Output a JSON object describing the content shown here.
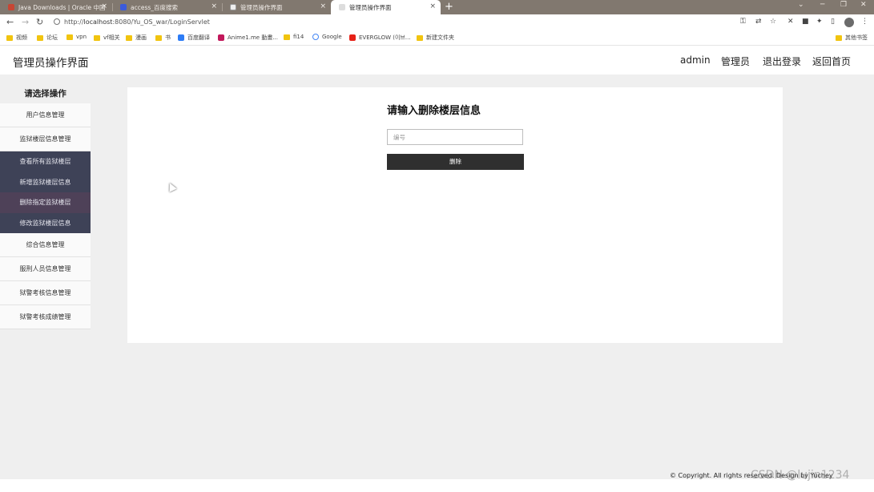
{
  "browser": {
    "tabs": [
      {
        "title": "Java Downloads | Oracle 中国"
      },
      {
        "title": "access_百度搜索"
      },
      {
        "title": "管理员操作界面"
      },
      {
        "title": "管理员操作界面"
      }
    ],
    "close_glyph": "×",
    "new_tab_glyph": "+",
    "address": {
      "protocol": "http://",
      "host": "localhost",
      "path": ":8080/Yu_OS_war/LoginServlet"
    },
    "bookmarks": [
      "视频",
      "论坛",
      "vpn",
      "vf相关",
      "漫画",
      "书",
      "百度翻译",
      "Anime1.me 動畫...",
      "fi14",
      "Google",
      "EVERGLOW (이브...",
      "新建文件夹"
    ],
    "other_bookmarks": "其他书签"
  },
  "header": {
    "title": "管理员操作界面",
    "links": [
      "admin",
      "管理员",
      "退出登录",
      "返回首页"
    ]
  },
  "sidebar": {
    "title": "请选择操作",
    "items_before": [
      "用户信息管理",
      "监狱楼层信息管理"
    ],
    "submenu": [
      "查看所有监狱楼层",
      "新增监狱楼层信息",
      "删除指定监狱楼层",
      "修改监狱楼层信息"
    ],
    "active_submenu_index": 2,
    "items_after": [
      "综合信息管理",
      "服刑人员信息管理",
      "狱警考核信息管理",
      "狱警考核成绩管理"
    ]
  },
  "form": {
    "title": "请输入删除楼层信息",
    "id_field": {
      "placeholder": "编号",
      "value": ""
    },
    "submit_label": "删除"
  },
  "footer": {
    "copyright": "© Copyright. All rights reserved. Design by Yuchey",
    "watermark": "CSDN @lujin1234"
  },
  "colors": {
    "tabbar": "#81786f",
    "submenu_bg": "#3e4257",
    "submenu_active": "#4e4158",
    "button_bg": "#2f2f2f",
    "page_bg": "#efefef"
  }
}
